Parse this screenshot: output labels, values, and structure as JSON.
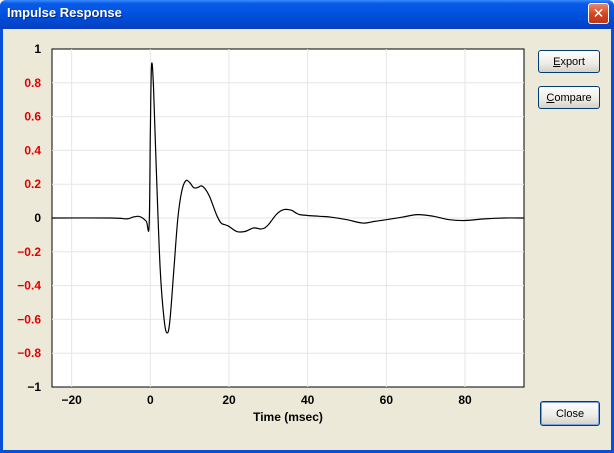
{
  "window": {
    "title": "Impulse Response",
    "close_glyph": "✕"
  },
  "buttons": {
    "export_label": "Export",
    "export_mnemonic": "E",
    "export_rest": "xport",
    "compare_label": "Compare",
    "compare_mnemonic": "C",
    "compare_rest": "ompare",
    "close_label": "Close"
  },
  "colors": {
    "title_bar": "#0052e0",
    "client_bg": "#ece9d8",
    "red_tick": "#e00000",
    "grid": "#e6e6e6",
    "trace": "#000000"
  },
  "chart_data": {
    "type": "line",
    "title": "",
    "xlabel": "Time (msec)",
    "ylabel": "",
    "xlim": [
      -25,
      95
    ],
    "ylim": [
      -1,
      1
    ],
    "grid": true,
    "xticks": [
      -20,
      0,
      20,
      40,
      60,
      80
    ],
    "xtick_labels": [
      "−20",
      "0",
      "20",
      "40",
      "60",
      "80"
    ],
    "yticks": [
      1,
      0.8,
      0.6,
      0.4,
      0.2,
      0,
      -0.2,
      -0.4,
      -0.6,
      -0.8,
      -1
    ],
    "ytick_labels": [
      "1",
      "0.8",
      "0.6",
      "0.4",
      "0.2",
      "0",
      "−0.2",
      "−0.4",
      "−0.6",
      "−0.8",
      "−1"
    ],
    "ytick_colors": [
      "black",
      "red",
      "red",
      "red",
      "red",
      "black",
      "red",
      "red",
      "red",
      "red",
      "black"
    ],
    "series": [
      {
        "x": [
          -25,
          -10,
          -6,
          -4.5,
          -3,
          -2,
          -1,
          -0.3,
          0,
          0.3,
          0.8,
          1.5,
          2.5,
          3.5,
          4.3,
          5,
          6,
          7,
          8,
          9,
          10,
          11,
          12,
          13,
          14,
          15,
          16,
          17,
          18,
          19,
          20,
          22,
          24,
          26,
          27,
          28,
          29,
          30,
          31,
          32,
          33,
          34,
          35,
          36,
          37,
          38,
          40,
          43,
          46,
          50,
          54,
          57,
          60,
          64,
          68,
          72,
          76,
          80,
          85,
          90,
          95
        ],
        "y": [
          0.0,
          0.0,
          -0.005,
          0.005,
          0.01,
          0.0,
          -0.02,
          -0.04,
          0.5,
          0.9,
          0.78,
          0.3,
          -0.3,
          -0.6,
          -0.68,
          -0.6,
          -0.3,
          0.0,
          0.16,
          0.22,
          0.21,
          0.18,
          0.18,
          0.19,
          0.17,
          0.13,
          0.07,
          0.01,
          -0.03,
          -0.04,
          -0.05,
          -0.08,
          -0.08,
          -0.06,
          -0.06,
          -0.065,
          -0.06,
          -0.04,
          -0.01,
          0.02,
          0.04,
          0.05,
          0.05,
          0.045,
          0.03,
          0.02,
          0.015,
          0.01,
          0.005,
          -0.01,
          -0.03,
          -0.02,
          -0.01,
          0.005,
          0.02,
          0.01,
          -0.01,
          -0.015,
          -0.005,
          0.0,
          0.0
        ]
      }
    ]
  }
}
